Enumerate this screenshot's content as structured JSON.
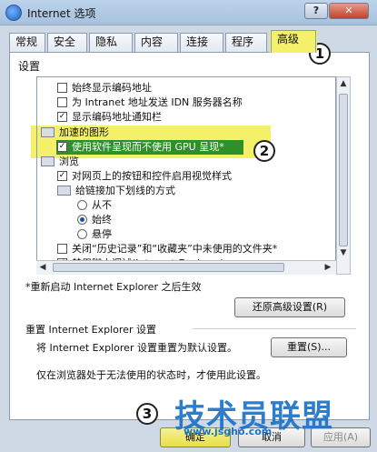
{
  "window": {
    "title": "Internet 选项",
    "help_label": "?",
    "close_label": "✕"
  },
  "tabs": [
    {
      "label": "常规"
    },
    {
      "label": "安全"
    },
    {
      "label": "隐私"
    },
    {
      "label": "内容"
    },
    {
      "label": "连接"
    },
    {
      "label": "程序"
    },
    {
      "label": "高级",
      "active": true
    }
  ],
  "settings": {
    "group_label": "设置",
    "items": [
      {
        "type": "checkbox",
        "checked": false,
        "label": "始终显示编码地址"
      },
      {
        "type": "checkbox",
        "checked": false,
        "label": "为 Intranet 地址发送 IDN 服务器名称"
      },
      {
        "type": "checkbox",
        "checked": true,
        "label": "显示编码地址通知栏"
      },
      {
        "type": "group",
        "label": "加速的图形"
      },
      {
        "type": "checkbox",
        "checked": true,
        "label": "使用软件呈现而不使用 GPU 呈现*"
      },
      {
        "type": "group",
        "label": "浏览"
      },
      {
        "type": "checkbox",
        "checked": true,
        "label": "对网页上的按钮和控件启用视觉样式"
      },
      {
        "type": "group",
        "label": "给链接加下划线的方式"
      },
      {
        "type": "radio",
        "checked": false,
        "label": "从不"
      },
      {
        "type": "radio",
        "checked": true,
        "label": "始终"
      },
      {
        "type": "radio",
        "checked": false,
        "label": "悬停"
      },
      {
        "type": "checkbox",
        "checked": false,
        "label": "关闭“历史记录”和“收藏夹”中未使用的文件夹*"
      },
      {
        "type": "checkbox",
        "checked": true,
        "label": "禁用脚本调试(Internet Explorer)"
      }
    ],
    "note": "*重新启动 Internet Explorer 之后生效",
    "restore_button": "还原高级设置(R)"
  },
  "reset": {
    "title": "重置 Internet Explorer 设置",
    "description": "将 Internet Explorer 设置重置为默认设置。",
    "button": "重置(S)...",
    "note": "仅在浏览器处于无法使用的状态时，才使用此设置。"
  },
  "footer": {
    "ok": "确定",
    "cancel": "取消",
    "apply": "应用(A)"
  },
  "callouts": [
    "1",
    "2",
    "3"
  ],
  "watermark": {
    "main": "技术员联盟",
    "url": "www.jsgho.com"
  },
  "colors": {
    "highlight_yellow": "#f4f06a",
    "highlight_green": "#2f8f2a",
    "watermark_blue": "#1b73c9"
  }
}
